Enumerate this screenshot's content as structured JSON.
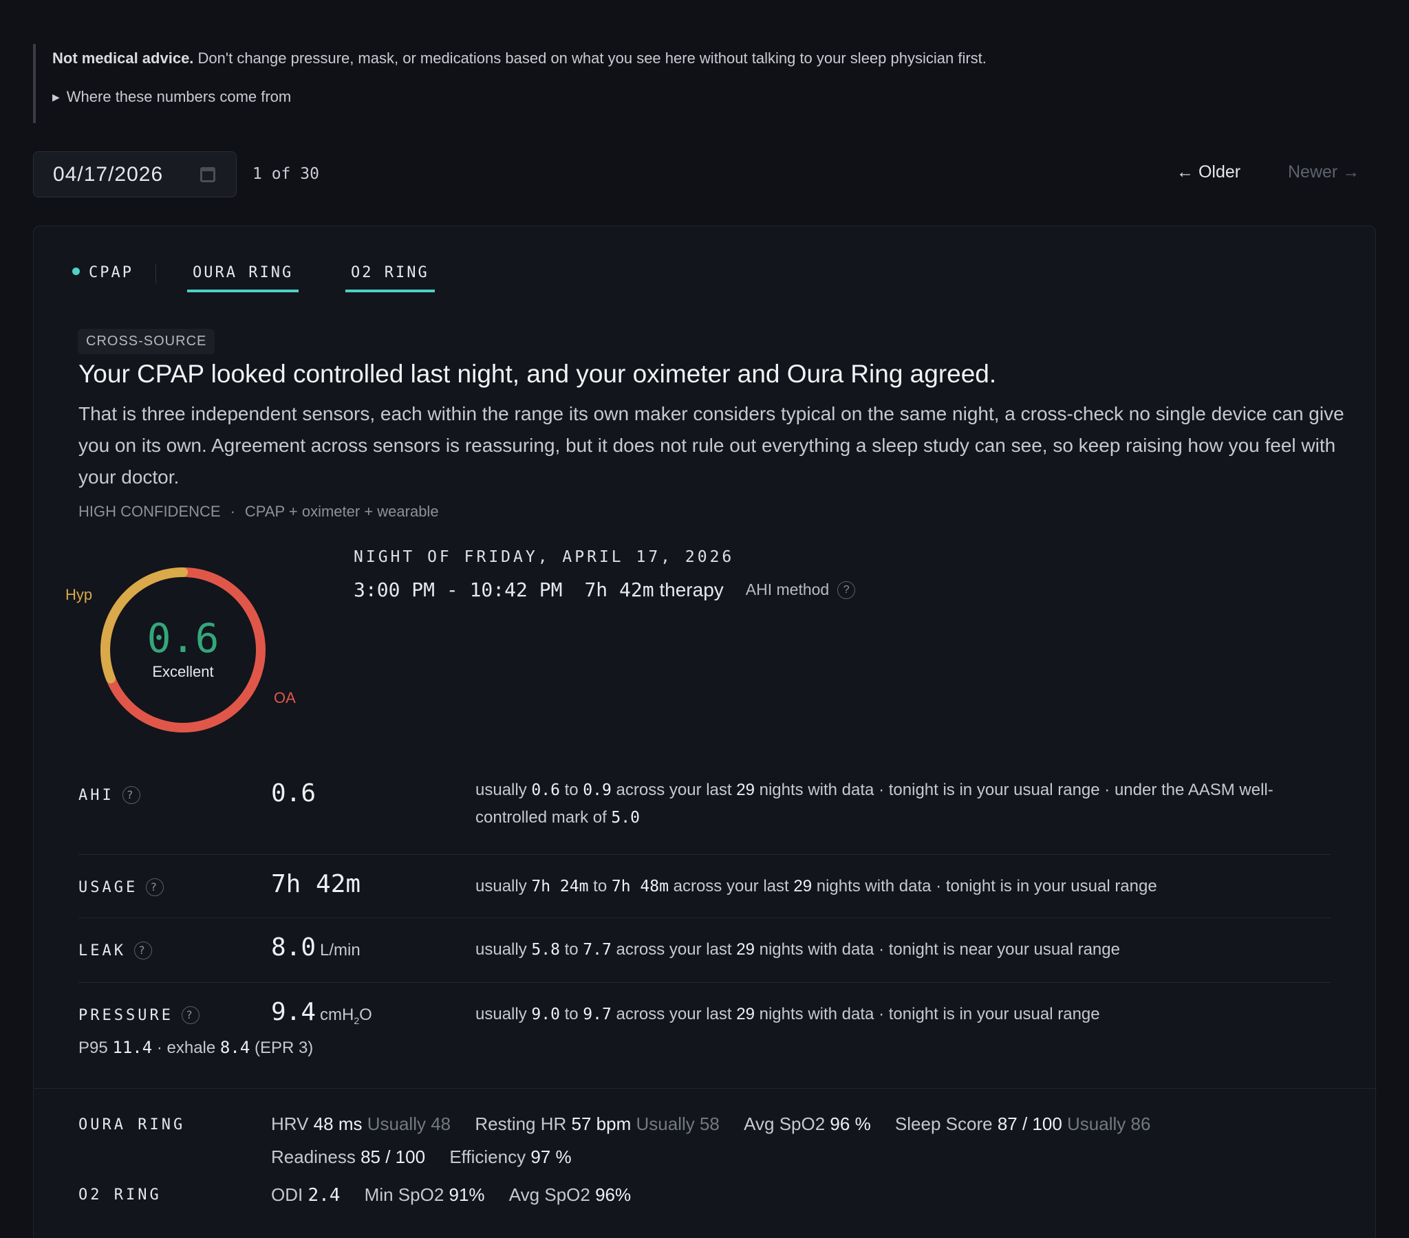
{
  "disclaimer": {
    "bold": "Not medical advice.",
    "text": " Don't change pressure, mask, or medications based on what you see here without talking to your sleep physician first.",
    "details_label": "Where these numbers come from"
  },
  "date_nav": {
    "date_value": "04/17/2026",
    "counter": "1 of 30",
    "older_label": "← Older",
    "newer_label": "Newer →"
  },
  "tabs": [
    {
      "label": "CPAP",
      "active": true
    },
    {
      "label": "OURA RING"
    },
    {
      "label": "O2 RING"
    }
  ],
  "insight": {
    "badge": "CROSS-SOURCE",
    "headline": "Your CPAP looked controlled last night, and your oximeter and Oura Ring agreed.",
    "body": "That is three independent sensors, each within the range its own maker considers typical on the same night, a cross-check no single device can give you on its own. Agreement across sensors is reassuring, but it does not rule out everything a sleep study can see, so keep raising how you feel with your doctor.",
    "confidence": "HIGH CONFIDENCE",
    "sources": "CPAP + oximeter + wearable"
  },
  "donut": {
    "score": "0.6",
    "rating": "Excellent",
    "hyp_label": "Hyp",
    "oa_label": "OA",
    "hyp_fraction": 0.31,
    "colors": {
      "hyp": "#d9a94a",
      "oa": "#e0574a",
      "score": "#34a77a"
    }
  },
  "night": {
    "title": "NIGHT OF FRIDAY, APRIL 17, 2026",
    "time_range": "3:00 PM - 10:42 PM",
    "therapy_value": "7h 42m",
    "therapy_word": "therapy",
    "ahi_method": "AHI method"
  },
  "metrics": {
    "ahi": {
      "label": "AHI",
      "value": "0.6",
      "usually_lo": "0.6",
      "usually_hi": "0.9",
      "nights": "29",
      "status": "tonight is in your usual range",
      "extra": "under the AASM well-controlled mark of",
      "extra_num": "5.0"
    },
    "usage": {
      "label": "USAGE",
      "value": "7h 42m",
      "usually_lo": "7h 24m",
      "usually_hi": "7h 48m",
      "nights": "29",
      "status": "tonight is in your usual range"
    },
    "leak": {
      "label": "LEAK",
      "value": "8.0",
      "unit": "L/min",
      "usually_lo": "5.8",
      "usually_hi": "7.7",
      "nights": "29",
      "status": "tonight is near your usual range"
    },
    "pressure": {
      "label": "PRESSURE",
      "value": "9.4",
      "unit_a": "cmH",
      "unit_sub": "2",
      "unit_b": "O",
      "usually_lo": "9.0",
      "usually_hi": "9.7",
      "nights": "29",
      "status": "tonight is in your usual range",
      "p95_label": "P95",
      "p95": "11.4",
      "exhale_label": "exhale",
      "exhale": "8.4",
      "epr": "(EPR 3)"
    }
  },
  "oura": {
    "label": "OURA RING",
    "hrv_label": "HRV",
    "hrv": "48 ms",
    "hrv_usually": "Usually 48",
    "rhr_label": "Resting HR",
    "rhr": "57 bpm",
    "rhr_usually": "Usually 58",
    "spo2_label": "Avg SpO2",
    "spo2": "96 %",
    "sleep_label": "Sleep Score",
    "sleep": "87 / 100",
    "sleep_usually": "Usually 86",
    "readiness_label": "Readiness",
    "readiness": "85 / 100",
    "efficiency_label": "Efficiency",
    "efficiency": "97 %"
  },
  "o2": {
    "label": "O2 RING",
    "odi_label": "ODI",
    "odi": "2.4",
    "min_label": "Min SpO2",
    "min": "91%",
    "avg_label": "Avg SpO2",
    "avg": "96%"
  },
  "common": {
    "usually": "usually",
    "to": "to",
    "across": "across your last",
    "nights_with_data": "nights with data",
    "dot": "·"
  }
}
